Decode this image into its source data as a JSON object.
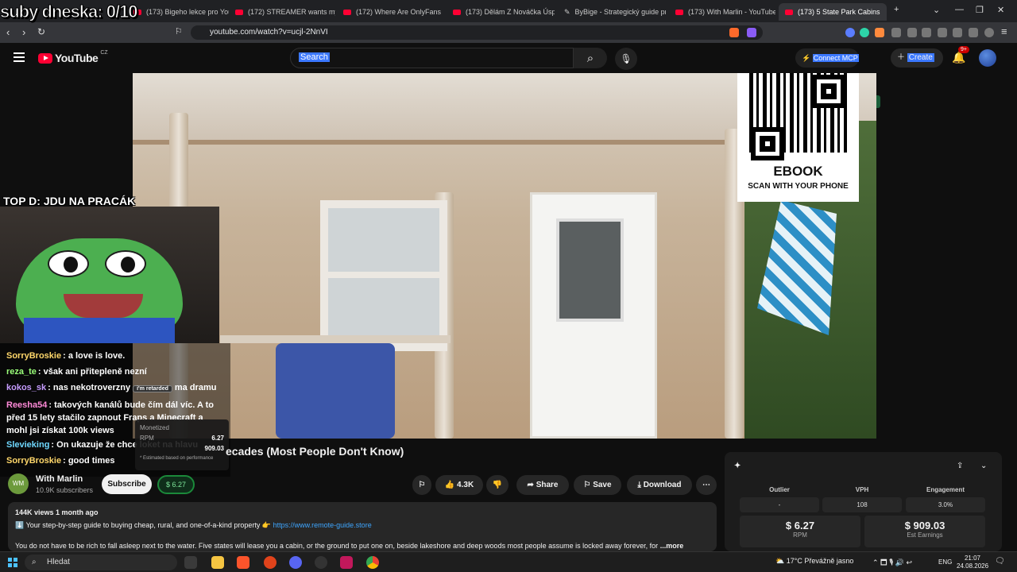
{
  "browser": {
    "tabs": [
      {
        "title": "(173) Bigeho lekce pro YouTub"
      },
      {
        "title": "(172) STREAMER wants my fri"
      },
      {
        "title": "(172) Where Are OnlyFans Mi"
      },
      {
        "title": "(173) Dělám Z Nováčka Úspě"
      },
      {
        "title": "ByBige - Strategický guide pro"
      },
      {
        "title": "(173) With Marlin - YouTube"
      },
      {
        "title": "(173) 5 State Park Cabins"
      }
    ],
    "url": "youtube.com/watch?v=ucjl-2NnVI"
  },
  "youtube": {
    "logo": "YouTube",
    "country": "CZ",
    "search_placeholder": "Search",
    "connect_mcp": "Connect MCP",
    "create_label": "Create",
    "notif_badge": "9+"
  },
  "overlay": {
    "counter": "suby dneska: 0/10",
    "topd": "TOP D: JDU NA PRACÁK",
    "chat": [
      {
        "user": "SorryBroskie",
        "color": "#ffd76a",
        "msg": ": a love is love."
      },
      {
        "user": "reza_te",
        "color": "#9bff7a",
        "msg": ": však ani přitepleně nezní"
      },
      {
        "user": "kokos_sk",
        "color": "#c69cff",
        "msg": ": nas nekotroverzny",
        "badge": "i'm retarded",
        "after": "ma dramu"
      },
      {
        "user": "Reesha54",
        "color": "#ff8ad8",
        "msg": ": takových kanálů bude čím dál víc. A to před 15 lety stačilo zapnout Fraps a Minecraft a mohl jsi získat 100k views"
      },
      {
        "user": "Slevieking",
        "color": "#6fd8ff",
        "msg": ": On ukazuje že chce loket na hlavu"
      },
      {
        "user": "SorryBroskie",
        "color": "#ffd76a",
        "msg": ": good times"
      }
    ],
    "monetized_label": "Monetized",
    "rpm_label": "RPM",
    "rpm_value": "6.27",
    "earn_value": "909.03",
    "estimated_note": "* Estimated based on performance"
  },
  "qr": {
    "title": "EBOOK",
    "subtitle": "SCAN WITH YOUR PHONE"
  },
  "video": {
    "title_visible": "ecades (Most People Don't Know)",
    "channel": "With Marlin",
    "subscribers": "10.9K subscribers",
    "subscribe_label": "Subscribe",
    "earnings_badge": "6.27",
    "likes": "4.3K",
    "share_label": "Share",
    "save_label": "Save",
    "download_label": "Download",
    "views_meta": "144K views  1 month ago",
    "desc_line1": "Your step-by-step guide to buying cheap, rural, and one-of-a-kind property",
    "desc_link": "https://www.remote-guide.store",
    "desc_line2": "You do not have to be rich to fall asleep next to the water. Five states will lease you a cabin, or the ground to put one on, beside lakeshore and deep woods most people assume is locked away forever, for",
    "more_label": "...more"
  },
  "stats": {
    "outlier_label": "Outlier",
    "outlier_value": "-",
    "vph_label": "VPH",
    "vph_value": "108",
    "engagement_label": "Engagement",
    "engagement_value": "3.0%",
    "rpm_value": "6.27",
    "rpm_label": "RPM",
    "earnings_value": "909.03",
    "earnings_label": "Est Earnings"
  },
  "taskbar": {
    "search_label": "Hledat",
    "weather": "17°C  Převážně jasno",
    "lang": "ENG",
    "time": "21:07",
    "date": "24.08.2026"
  }
}
